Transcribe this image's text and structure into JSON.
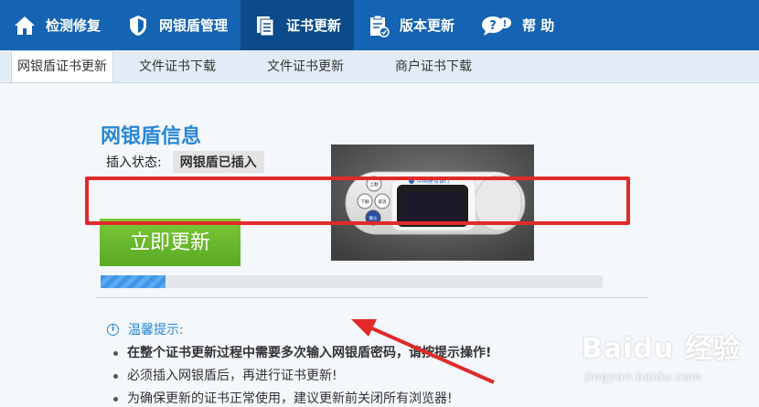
{
  "nav": {
    "items": [
      {
        "label": "检测修复",
        "icon": "home-icon"
      },
      {
        "label": "网银盾管理",
        "icon": "shield-icon"
      },
      {
        "label": "证书更新",
        "icon": "document-icon"
      },
      {
        "label": "版本更新",
        "icon": "clipboard-icon"
      },
      {
        "label": "帮 助",
        "icon": "help-bubble-icon"
      }
    ],
    "active_index": 2
  },
  "subtabs": [
    "网银盾证书更新",
    "文件证书下载",
    "文件证书更新",
    "商户证书下载"
  ],
  "info": {
    "title": "网银盾信息",
    "status_label": "插入状态:",
    "status_value": "网银盾已插入"
  },
  "device": {
    "bank_name": "中国建设银行",
    "keys": [
      "上翻",
      "下翻",
      "取消",
      "确认"
    ]
  },
  "update_button": "立即更新",
  "progress": {
    "value": 0.13
  },
  "tips": {
    "header": "温馨提示:",
    "items": [
      "在整个证书更新过程中需要多次输入网银盾密码，请按提示操作!",
      "必须插入网银盾后，再进行证书更新!",
      "为确保更新的证书正常使用，建议更新前关闭所有浏览器!"
    ]
  },
  "watermark": {
    "logo": "Baidu 经验",
    "url": "jingyan.baidu.com"
  },
  "colors": {
    "nav": "#1563b3",
    "nav_active": "#0c4a8a",
    "accent": "#2a87d6",
    "button": "#5aa924",
    "highlight": "#e02a2a"
  }
}
